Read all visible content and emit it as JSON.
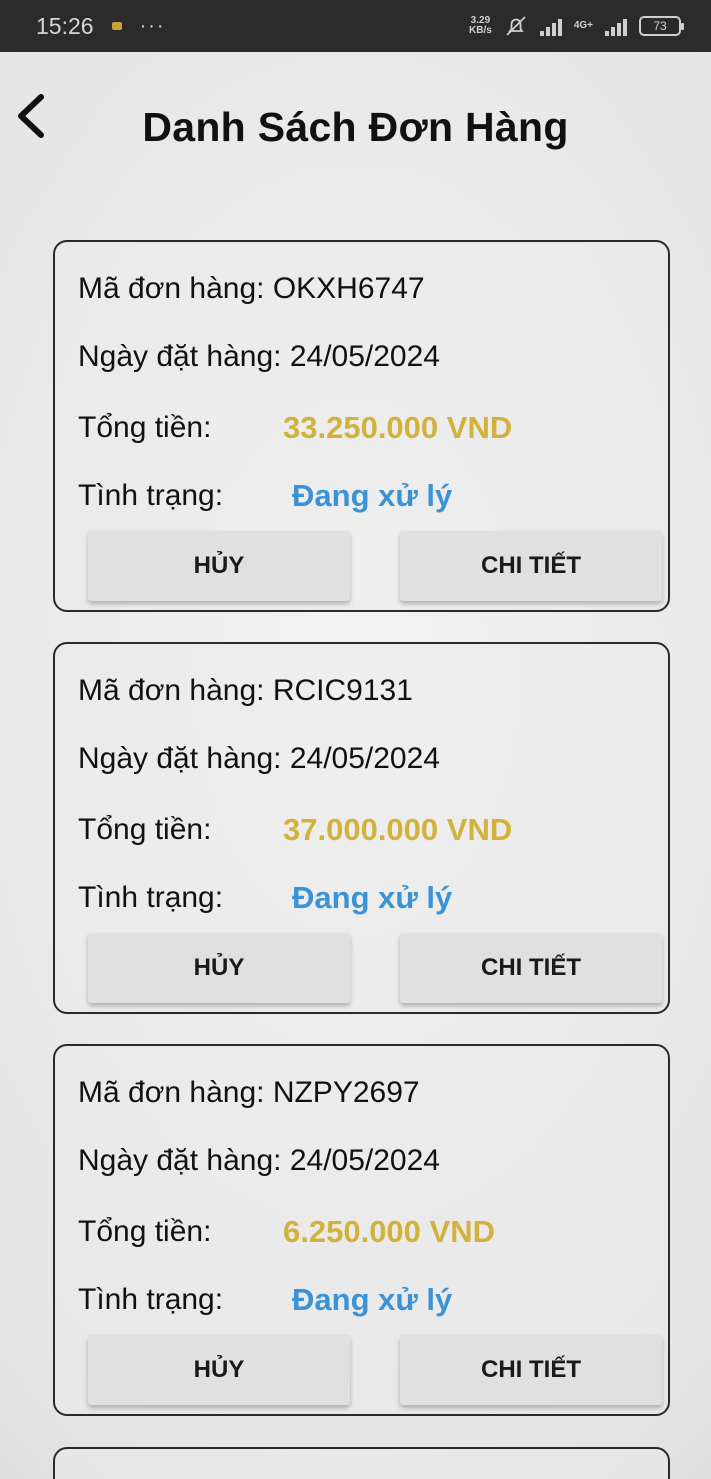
{
  "status_bar": {
    "time": "15:26",
    "dots": "···",
    "net_speed_value": "3.29",
    "net_speed_unit": "KB/s",
    "net_type": "4G+",
    "battery": "73"
  },
  "header": {
    "title": "Danh Sách Đơn Hàng",
    "back_icon": "chevron-left-icon"
  },
  "labels": {
    "code": "Mã đơn hàng: ",
    "date": "Ngày đặt hàng: ",
    "total": "Tổng tiền:",
    "status": "Tình trạng:",
    "cancel_button": "HỦY",
    "detail_button": "CHI TIẾT"
  },
  "orders": [
    {
      "code": "OKXH6747",
      "date": "24/05/2024",
      "total": "33.250.000 VND",
      "status": "Đang xử lý"
    },
    {
      "code": "RCIC9131",
      "date": "24/05/2024",
      "total": "37.000.000 VND",
      "status": "Đang xử lý"
    },
    {
      "code": "NZPY2697",
      "date": "24/05/2024",
      "total": "6.250.000 VND",
      "status": "Đang xử lý"
    }
  ],
  "colors": {
    "amount": "#d1b23c",
    "status": "#3b93d6",
    "status_bar_bg": "#2b2b2b"
  }
}
